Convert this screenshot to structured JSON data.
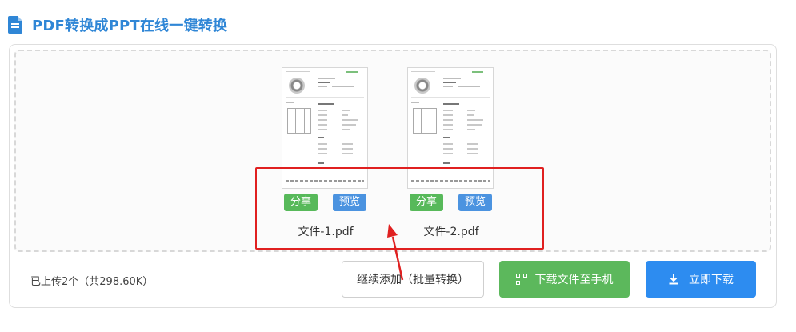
{
  "header": {
    "title": "PDF转换成PPT在线一键转换",
    "icon": "document-icon",
    "color": "#2f86d6"
  },
  "files": [
    {
      "name": "文件-1.pdf",
      "share_label": "分享",
      "preview_label": "预览"
    },
    {
      "name": "文件-2.pdf",
      "share_label": "分享",
      "preview_label": "预览"
    }
  ],
  "footer": {
    "status": "已上传2个（共298.60K）",
    "continue_label": "继续添加（批量转换）",
    "phone_label": "下载文件至手机",
    "download_label": "立即下载"
  },
  "colors": {
    "share": "#57b95a",
    "preview": "#4b93e0",
    "phone": "#5cb85c",
    "download": "#2d8cf0",
    "annotation": "#e02020"
  }
}
